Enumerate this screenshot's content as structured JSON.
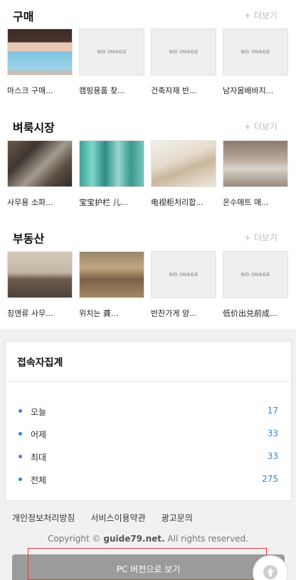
{
  "sections": [
    {
      "title": "구매",
      "more": "더보기",
      "items": [
        {
          "caption": "마스크 구매...",
          "image": "photo"
        },
        {
          "caption": "캠핑용품 찾...",
          "image": "no-image"
        },
        {
          "caption": "건축자재 반...",
          "image": "no-image"
        },
        {
          "caption": "남자몸배바지...",
          "image": "no-image"
        }
      ]
    },
    {
      "title": "벼룩시장",
      "more": "더보기",
      "items": [
        {
          "caption": "사무용 소파...",
          "image": "photo"
        },
        {
          "caption": "宝宝护栏 儿...",
          "image": "photo"
        },
        {
          "caption": "电视柜처리합...",
          "image": "photo"
        },
        {
          "caption": "온수매트 애...",
          "image": "photo"
        }
      ]
    },
    {
      "title": "부동산",
      "more": "더보기",
      "items": [
        {
          "caption": "칭앤류 사무...",
          "image": "photo"
        },
        {
          "caption": "위치는 龚...",
          "image": "photo"
        },
        {
          "caption": "반찬가게 양...",
          "image": "no-image"
        },
        {
          "caption": "低价出兑前成...",
          "image": "no-image"
        }
      ]
    }
  ],
  "no_image_text": "NO IMAGE",
  "stats": {
    "title": "접속자집계",
    "rows": [
      {
        "label": "오늘",
        "value": "17"
      },
      {
        "label": "어제",
        "value": "33"
      },
      {
        "label": "최대",
        "value": "33"
      },
      {
        "label": "전체",
        "value": "275"
      }
    ]
  },
  "footer": {
    "links": [
      "개인정보처리방침",
      "서비스이용약관",
      "광고문의"
    ],
    "copyright_prefix": "Copyright ©",
    "copyright_site": "guide79.net.",
    "copyright_suffix": "All rights reserved.",
    "pc_button": "PC 버전으로 보기"
  },
  "icons": {
    "more": "plus-icon",
    "stat_bullet": "dot-icon",
    "top": "arrow-up-icon"
  },
  "colors": {
    "accent": "#3a7fd5",
    "highlight": "#e53b3b",
    "button_bg": "#9b9b9b"
  }
}
